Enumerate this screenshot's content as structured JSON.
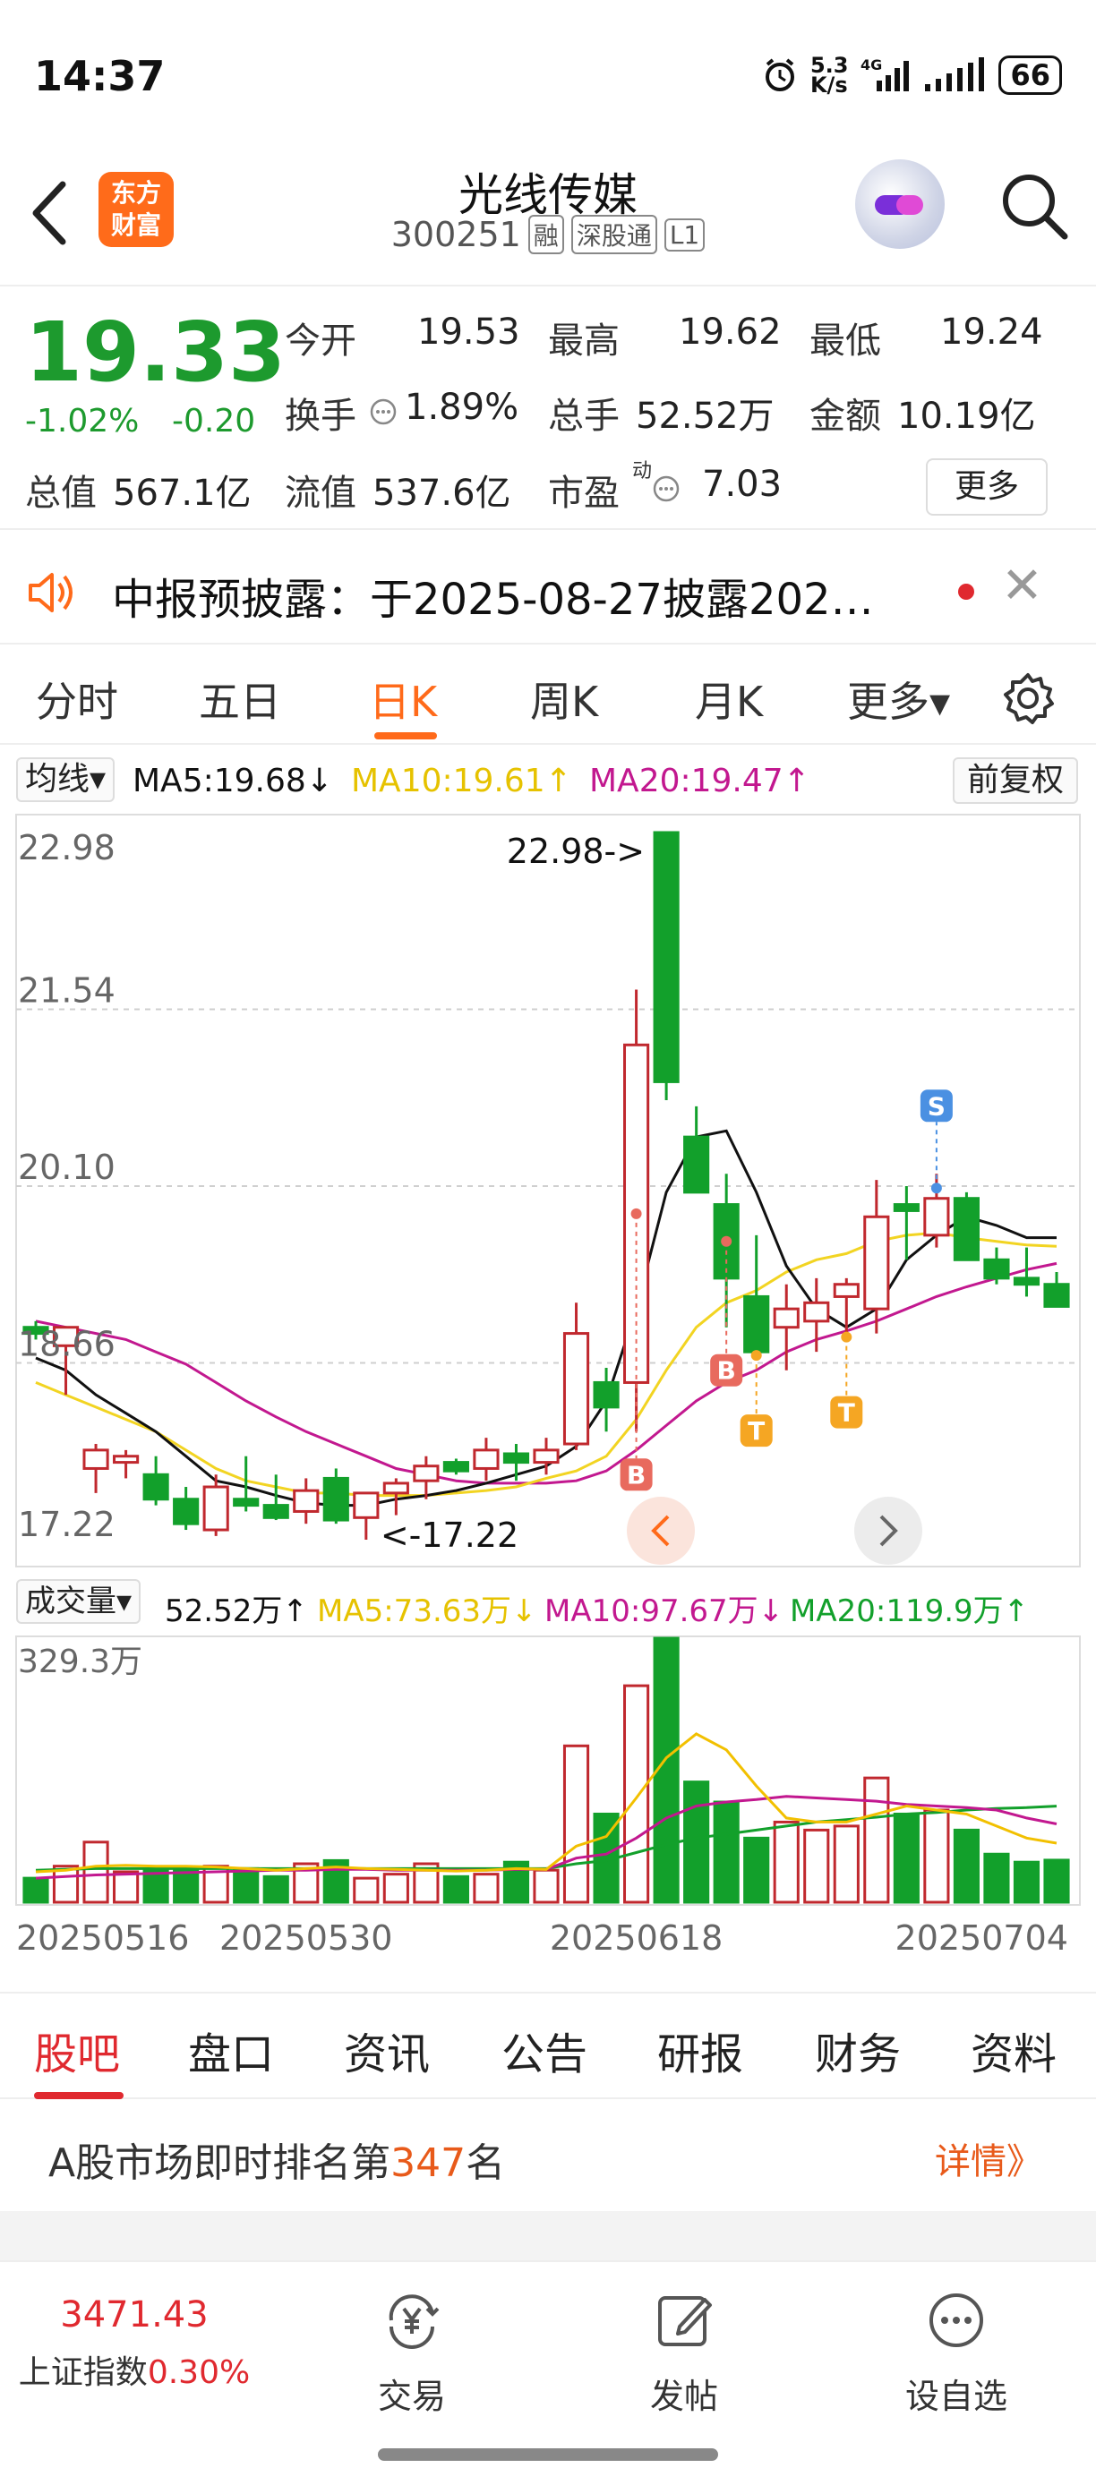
{
  "status_bar": {
    "time": "14:37",
    "net_speed_top": "5.3",
    "net_speed_bottom": "K/s",
    "network": "4G",
    "battery": "66"
  },
  "header": {
    "logo_line1": "东方",
    "logo_line2": "财富",
    "stock_name": "光线传媒",
    "stock_code": "300251",
    "badges": [
      "融",
      "深股通",
      "L1"
    ]
  },
  "quote": {
    "price": "19.33",
    "change_pct": "-1.02%",
    "change": "-0.20",
    "open_label": "今开",
    "open": "19.53",
    "high_label": "最高",
    "high": "19.62",
    "low_label": "最低",
    "low": "19.24",
    "turnover_label": "换手",
    "turnover": "1.89%",
    "volume_label": "总手",
    "volume": "52.52万",
    "amount_label": "金额",
    "amount": "10.19亿",
    "mktcap_label": "总值",
    "mktcap": "567.1亿",
    "float_label": "流值",
    "float_cap": "537.6亿",
    "pe_label": "市盈",
    "pe_sup": "动",
    "pe": "7.03",
    "more_label": "更多"
  },
  "notice": {
    "text": "中报预披露：于2025-08-27披露202…"
  },
  "period_tabs": {
    "items": [
      "分时",
      "五日",
      "日K",
      "周K",
      "月K",
      "更多▾"
    ],
    "active": "日K"
  },
  "ma_legend": {
    "selector": "均线▾",
    "ma5": "MA5:19.68↓",
    "ma10": "MA10:19.61↑",
    "ma20": "MA20:19.47↑",
    "adjust_button": "前复权"
  },
  "vol_legend": {
    "selector": "成交量▾",
    "vol": "52.52万↑",
    "ma5": "MA5:73.63万↓",
    "ma10": "MA10:97.67万↓",
    "ma20": "MA20:119.9万↑"
  },
  "chart_data": {
    "type": "candlestick",
    "y_axis_labels": [
      "22.98",
      "21.54",
      "20.10",
      "18.66",
      "17.22"
    ],
    "ylim": [
      17.22,
      22.98
    ],
    "max_annotation": "22.98->",
    "min_annotation": "<-17.22",
    "x_labels": [
      "20250516",
      "20250530",
      "20250618",
      "20250704"
    ],
    "candles": [
      {
        "o": 18.95,
        "h": 19.0,
        "l": 18.85,
        "c": 18.9
      },
      {
        "o": 18.8,
        "h": 18.95,
        "l": 18.4,
        "c": 18.95
      },
      {
        "o": 17.8,
        "h": 18.0,
        "l": 17.6,
        "c": 17.95
      },
      {
        "o": 17.85,
        "h": 17.95,
        "l": 17.72,
        "c": 17.9
      },
      {
        "o": 17.75,
        "h": 17.9,
        "l": 17.5,
        "c": 17.55
      },
      {
        "o": 17.55,
        "h": 17.65,
        "l": 17.3,
        "c": 17.35
      },
      {
        "o": 17.3,
        "h": 17.75,
        "l": 17.25,
        "c": 17.65
      },
      {
        "o": 17.55,
        "h": 17.9,
        "l": 17.45,
        "c": 17.5
      },
      {
        "o": 17.5,
        "h": 17.75,
        "l": 17.38,
        "c": 17.4
      },
      {
        "o": 17.45,
        "h": 17.72,
        "l": 17.35,
        "c": 17.62
      },
      {
        "o": 17.72,
        "h": 17.8,
        "l": 17.35,
        "c": 17.38
      },
      {
        "o": 17.4,
        "h": 17.6,
        "l": 17.22,
        "c": 17.6
      },
      {
        "o": 17.6,
        "h": 17.72,
        "l": 17.42,
        "c": 17.68
      },
      {
        "o": 17.7,
        "h": 17.9,
        "l": 17.55,
        "c": 17.82
      },
      {
        "o": 17.85,
        "h": 17.88,
        "l": 17.75,
        "c": 17.78
      },
      {
        "o": 17.8,
        "h": 18.05,
        "l": 17.7,
        "c": 17.95
      },
      {
        "o": 17.92,
        "h": 18.0,
        "l": 17.7,
        "c": 17.85
      },
      {
        "o": 17.85,
        "h": 18.05,
        "l": 17.75,
        "c": 17.95
      },
      {
        "o": 18.0,
        "h": 19.15,
        "l": 17.95,
        "c": 18.9
      },
      {
        "o": 18.5,
        "h": 18.62,
        "l": 18.1,
        "c": 18.3
      },
      {
        "o": 18.5,
        "h": 21.7,
        "l": 18.1,
        "c": 21.25
      },
      {
        "o": 22.98,
        "h": 22.98,
        "l": 20.8,
        "c": 20.95
      },
      {
        "o": 20.5,
        "h": 20.75,
        "l": 20.05,
        "c": 20.05
      },
      {
        "o": 19.95,
        "h": 20.2,
        "l": 18.95,
        "c": 19.35
      },
      {
        "o": 19.2,
        "h": 19.7,
        "l": 18.75,
        "c": 18.75
      },
      {
        "o": 18.95,
        "h": 19.3,
        "l": 18.6,
        "c": 19.1
      },
      {
        "o": 19.0,
        "h": 19.35,
        "l": 18.75,
        "c": 19.15
      },
      {
        "o": 19.2,
        "h": 19.35,
        "l": 18.9,
        "c": 19.3
      },
      {
        "o": 19.1,
        "h": 20.15,
        "l": 18.9,
        "c": 19.85
      },
      {
        "o": 19.95,
        "h": 20.1,
        "l": 19.5,
        "c": 19.9
      },
      {
        "o": 19.7,
        "h": 20.2,
        "l": 19.6,
        "c": 20.0
      },
      {
        "o": 20.0,
        "h": 20.05,
        "l": 19.5,
        "c": 19.5
      },
      {
        "o": 19.5,
        "h": 19.6,
        "l": 19.3,
        "c": 19.35
      },
      {
        "o": 19.35,
        "h": 19.6,
        "l": 19.2,
        "c": 19.3
      },
      {
        "o": 19.3,
        "h": 19.4,
        "l": 19.12,
        "c": 19.12
      }
    ],
    "ma5": [
      18.7,
      18.6,
      18.4,
      18.25,
      18.1,
      17.9,
      17.7,
      17.65,
      17.58,
      17.52,
      17.5,
      17.5,
      17.55,
      17.58,
      17.62,
      17.68,
      17.75,
      17.82,
      17.98,
      18.35,
      19.1,
      20.05,
      20.5,
      20.55,
      20.05,
      19.45,
      19.1,
      18.95,
      19.1,
      19.5,
      19.7,
      19.85,
      19.78,
      19.68,
      19.68
    ],
    "ma10": [
      18.5,
      18.4,
      18.3,
      18.2,
      18.1,
      17.95,
      17.8,
      17.7,
      17.65,
      17.6,
      17.6,
      17.58,
      17.58,
      17.58,
      17.6,
      17.62,
      17.65,
      17.72,
      17.78,
      17.9,
      18.2,
      18.6,
      18.95,
      19.15,
      19.25,
      19.4,
      19.5,
      19.55,
      19.65,
      19.7,
      19.72,
      19.68,
      19.65,
      19.62,
      19.61
    ],
    "ma20": [
      19.0,
      18.95,
      18.9,
      18.85,
      18.75,
      18.65,
      18.5,
      18.35,
      18.22,
      18.1,
      18.0,
      17.9,
      17.8,
      17.75,
      17.7,
      17.68,
      17.68,
      17.68,
      17.7,
      17.78,
      17.95,
      18.15,
      18.35,
      18.5,
      18.6,
      18.75,
      18.85,
      18.92,
      19.0,
      19.1,
      19.2,
      19.28,
      19.35,
      19.42,
      19.47
    ],
    "signals": [
      {
        "index": 20,
        "label": "B",
        "kind": "buy"
      },
      {
        "index": 23,
        "label": "B",
        "kind": "buy"
      },
      {
        "index": 24,
        "label": "T",
        "kind": "t"
      },
      {
        "index": 27,
        "label": "T",
        "kind": "t"
      },
      {
        "index": 30,
        "label": "S",
        "kind": "sell"
      }
    ],
    "volume_axis_label": "329.3万",
    "volume_max": 329.3,
    "volume": [
      30,
      45,
      75,
      38,
      40,
      40,
      45,
      42,
      32,
      48,
      52,
      30,
      35,
      48,
      32,
      35,
      50,
      40,
      195,
      110,
      270,
      329.3,
      150,
      125,
      80,
      100,
      90,
      95,
      155,
      110,
      115,
      90,
      60,
      50,
      52.52
    ],
    "vol_ma5": [
      38,
      40,
      45,
      46,
      45,
      45,
      44,
      42,
      40,
      42,
      44,
      42,
      41,
      40,
      39,
      40,
      42,
      41,
      70,
      82,
      130,
      180,
      210,
      190,
      145,
      105,
      100,
      100,
      110,
      120,
      115,
      110,
      95,
      80,
      73.63
    ],
    "vol_ma10": [
      30,
      32,
      34,
      35,
      36,
      37,
      38,
      39,
      40,
      40,
      41,
      41,
      40,
      40,
      40,
      40,
      41,
      41,
      55,
      60,
      80,
      105,
      120,
      125,
      128,
      132,
      130,
      128,
      126,
      122,
      120,
      118,
      115,
      105,
      97.67
    ],
    "vol_ma20": [
      40,
      41,
      42,
      42,
      42,
      42,
      42,
      42,
      42,
      42,
      42,
      42,
      42,
      42,
      42,
      42,
      42,
      42,
      48,
      52,
      62,
      72,
      80,
      85,
      90,
      95,
      100,
      103,
      106,
      110,
      112,
      115,
      117,
      118,
      119.9
    ]
  },
  "bottom_tabs": {
    "items": [
      "股吧",
      "盘口",
      "资讯",
      "公告",
      "研报",
      "财务",
      "资料"
    ],
    "active": "股吧"
  },
  "rank": {
    "prefix": "A股市场即时排名第",
    "number": "347",
    "suffix": "名",
    "detail": "详情》"
  },
  "bottom_bar": {
    "index_value": "3471.43",
    "index_name": "上证指数",
    "index_change": "0.30%",
    "trade": "交易",
    "post": "发帖",
    "watchlist": "设自选"
  },
  "colors": {
    "up": "#c0282e",
    "down": "#12a02b",
    "ma5": "#111111",
    "ma10": "#f2d422",
    "ma20": "#c2188f",
    "accent": "#ff6a1a"
  }
}
